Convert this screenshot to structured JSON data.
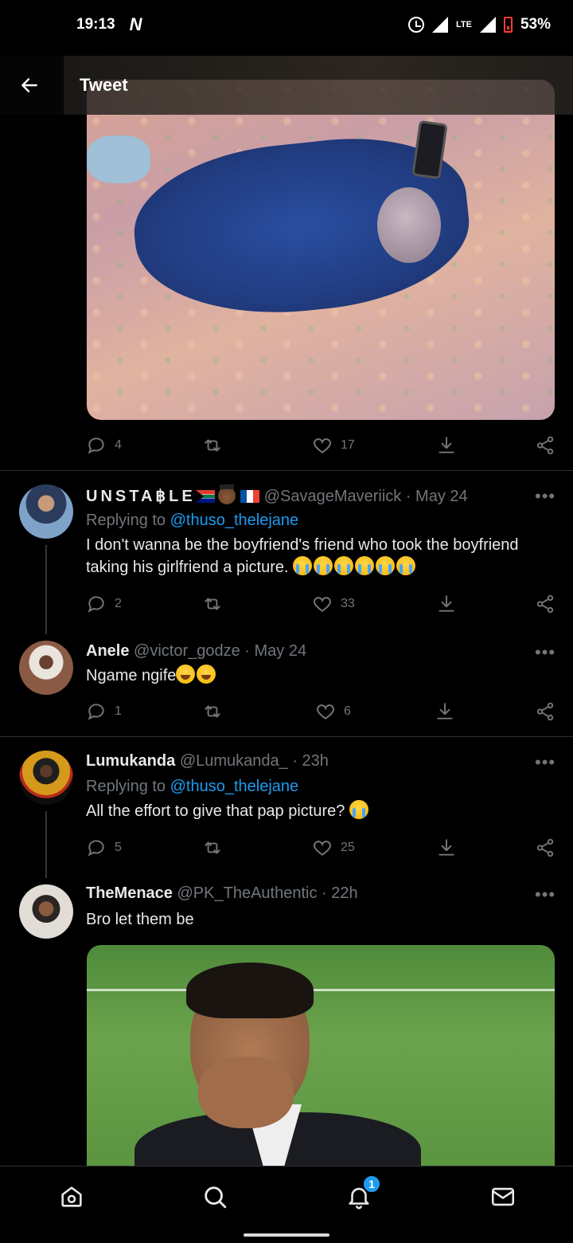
{
  "status_bar": {
    "time": "19:13",
    "network": "LTE",
    "battery": "53%"
  },
  "header": {
    "title": "Tweet"
  },
  "main_tweet_actions": {
    "replies": "4",
    "retweets": "",
    "likes": "17"
  },
  "replies": [
    {
      "name": "UNSTA฿LE",
      "handle": "@SavageMaveriick",
      "time": "· May 24",
      "replying_prefix": "Replying to",
      "replying_to": "@thuso_thelejane",
      "text": "I don't wanna be the boyfriend's friend who took the boyfriend taking his girlfriend a picture.",
      "replies": "2",
      "likes": "33"
    },
    {
      "name": "Anele",
      "handle": "@victor_godze",
      "time": "· May 24",
      "text": "Ngame ngife",
      "replies": "1",
      "likes": "6"
    },
    {
      "name": "Lumukanda",
      "handle": "@Lumukanda_",
      "time": "· 23h",
      "replying_prefix": "Replying to",
      "replying_to": "@thuso_thelejane",
      "text": "All the effort to give that pap picture?",
      "replies": "5",
      "likes": "25"
    },
    {
      "name": "TheMenace",
      "handle": "@PK_TheAuthentic",
      "time": "· 22h",
      "text": "Bro let them be"
    }
  ],
  "more_label": "•••",
  "bottom_nav": {
    "notifications_badge": "1"
  },
  "colors": {
    "accent": "#1d9bf0",
    "muted": "#71767b",
    "background": "#000000",
    "text": "#e7e9ea"
  }
}
